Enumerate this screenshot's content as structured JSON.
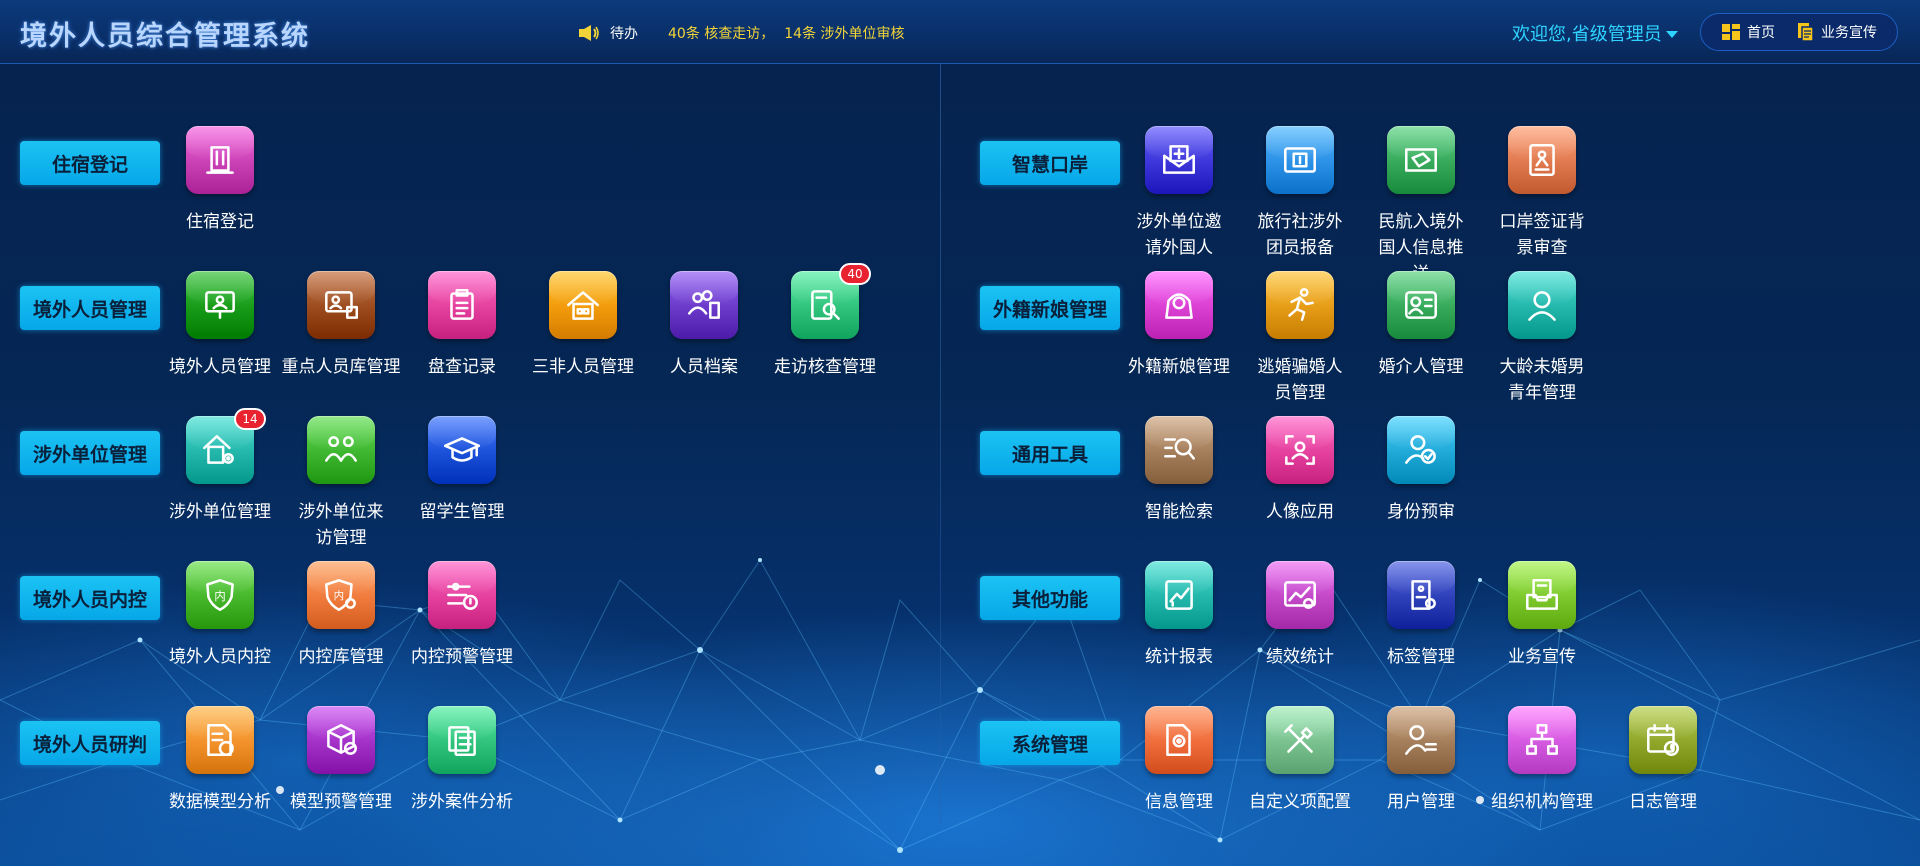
{
  "header": {
    "title": "境外人员综合管理系统",
    "todo_label": "待办",
    "notice_1": "40条 核查走访，",
    "notice_2": "14条 涉外单位审核",
    "welcome": "欢迎您,省级管理员",
    "nav": [
      {
        "label": "首页",
        "icon": "home-icon"
      },
      {
        "label": "业务宣传",
        "icon": "document-icon"
      }
    ]
  },
  "colors": {
    "accent": "#07a7e8",
    "header_bg": "#0a2f68",
    "notice_text": "#f3d438",
    "welcome_text": "#2fd3ff",
    "badge": "#e8232f"
  },
  "left_groups": [
    {
      "category": "住宿登记",
      "items": [
        {
          "label": "住宿登记",
          "icon": "building-icon",
          "color": "#c93fb4"
        }
      ]
    },
    {
      "category": "境外人员管理",
      "items": [
        {
          "label": "境外人员管理",
          "icon": "presenter-icon",
          "color": "#169a18"
        },
        {
          "label": "重点人员库管理",
          "icon": "presenter-list-icon",
          "color": "#9a4a1c"
        },
        {
          "label": "盘查记录",
          "icon": "clipboard-icon",
          "color": "#e43f9c"
        },
        {
          "label": "三非人员管理",
          "icon": "house-icon",
          "color": "#f29a0b"
        },
        {
          "label": "人员档案",
          "icon": "people-archive-icon",
          "color": "#6a39c8"
        },
        {
          "label": "走访核查管理",
          "icon": "search-document-icon",
          "color": "#2ec27b",
          "badge": "40"
        }
      ]
    },
    {
      "category": "涉外单位管理",
      "items": [
        {
          "label": "涉外单位管理",
          "icon": "house-gear-icon",
          "color": "#22b5a9",
          "badge": "14"
        },
        {
          "label": "涉外单位来访管理",
          "icon": "visitors-icon",
          "color": "#3db52f"
        },
        {
          "label": "留学生管理",
          "icon": "graduation-cap-icon",
          "color": "#1a4fd8"
        }
      ]
    },
    {
      "category": "境外人员内控",
      "items": [
        {
          "label": "境外人员内控",
          "icon": "shield-icon",
          "color": "#45b52a"
        },
        {
          "label": "内控库管理",
          "icon": "shield-gear-icon",
          "color": "#ef7a3c"
        },
        {
          "label": "内控预警管理",
          "icon": "sliders-alert-icon",
          "color": "#e43f9c"
        }
      ]
    },
    {
      "category": "境外人员研判",
      "items": [
        {
          "label": "数据模型分析",
          "icon": "chart-document-icon",
          "color": "#f2902a"
        },
        {
          "label": "模型预警管理",
          "icon": "cube-alert-icon",
          "color": "#a22fc6"
        },
        {
          "label": "涉外案件分析",
          "icon": "files-icon",
          "color": "#2ec27b"
        }
      ]
    }
  ],
  "right_groups": [
    {
      "category": "智慧口岸",
      "items": [
        {
          "label": "涉外单位邀请外国人",
          "icon": "mail-plus-icon",
          "color": "#3b34d8"
        },
        {
          "label": "旅行社涉外团员报备",
          "icon": "ticket-icon",
          "color": "#2a8fe6"
        },
        {
          "label": "民航入境外国人信息推送",
          "icon": "boarding-pass-icon",
          "color": "#35a85a"
        },
        {
          "label": "口岸签证背景审查",
          "icon": "id-card-icon",
          "color": "#e0784e"
        }
      ]
    },
    {
      "category": "外籍新娘管理",
      "items": [
        {
          "label": "外籍新娘管理",
          "icon": "bride-icon",
          "color": "#d93fd1"
        },
        {
          "label": "逃婚骗婚人员管理",
          "icon": "running-icon",
          "color": "#e59b16"
        },
        {
          "label": "婚介人管理",
          "icon": "contact-card-icon",
          "color": "#35a85a"
        },
        {
          "label": "大龄未婚男青年管理",
          "icon": "person-icon",
          "color": "#22b5a9"
        }
      ]
    },
    {
      "category": "通用工具",
      "items": [
        {
          "label": "智能检索",
          "icon": "search-list-icon",
          "color": "#a37d5a"
        },
        {
          "label": "人像应用",
          "icon": "face-scan-icon",
          "color": "#e43f9c"
        },
        {
          "label": "身份预审",
          "icon": "user-check-icon",
          "color": "#1fa7d6"
        }
      ]
    },
    {
      "category": "其他功能",
      "items": [
        {
          "label": "统计报表",
          "icon": "report-chart-icon",
          "color": "#22b5a9"
        },
        {
          "label": "绩效统计",
          "icon": "performance-chart-icon",
          "color": "#c147c7"
        },
        {
          "label": "标签管理",
          "icon": "tag-gear-icon",
          "color": "#2d3fb8"
        },
        {
          "label": "业务宣传",
          "icon": "inbox-icon",
          "color": "#7cc72c"
        }
      ]
    },
    {
      "category": "系统管理",
      "items": [
        {
          "label": "信息管理",
          "icon": "document-gear-icon",
          "color": "#ef6b3a"
        },
        {
          "label": "自定义项配置",
          "icon": "tools-icon",
          "color": "#78c08e"
        },
        {
          "label": "用户管理",
          "icon": "user-list-icon",
          "color": "#a37d5a"
        },
        {
          "label": "组织机构管理",
          "icon": "org-chart-icon",
          "color": "#d358e0"
        },
        {
          "label": "日志管理",
          "icon": "calendar-clock-icon",
          "color": "#8ea52a"
        }
      ]
    }
  ]
}
